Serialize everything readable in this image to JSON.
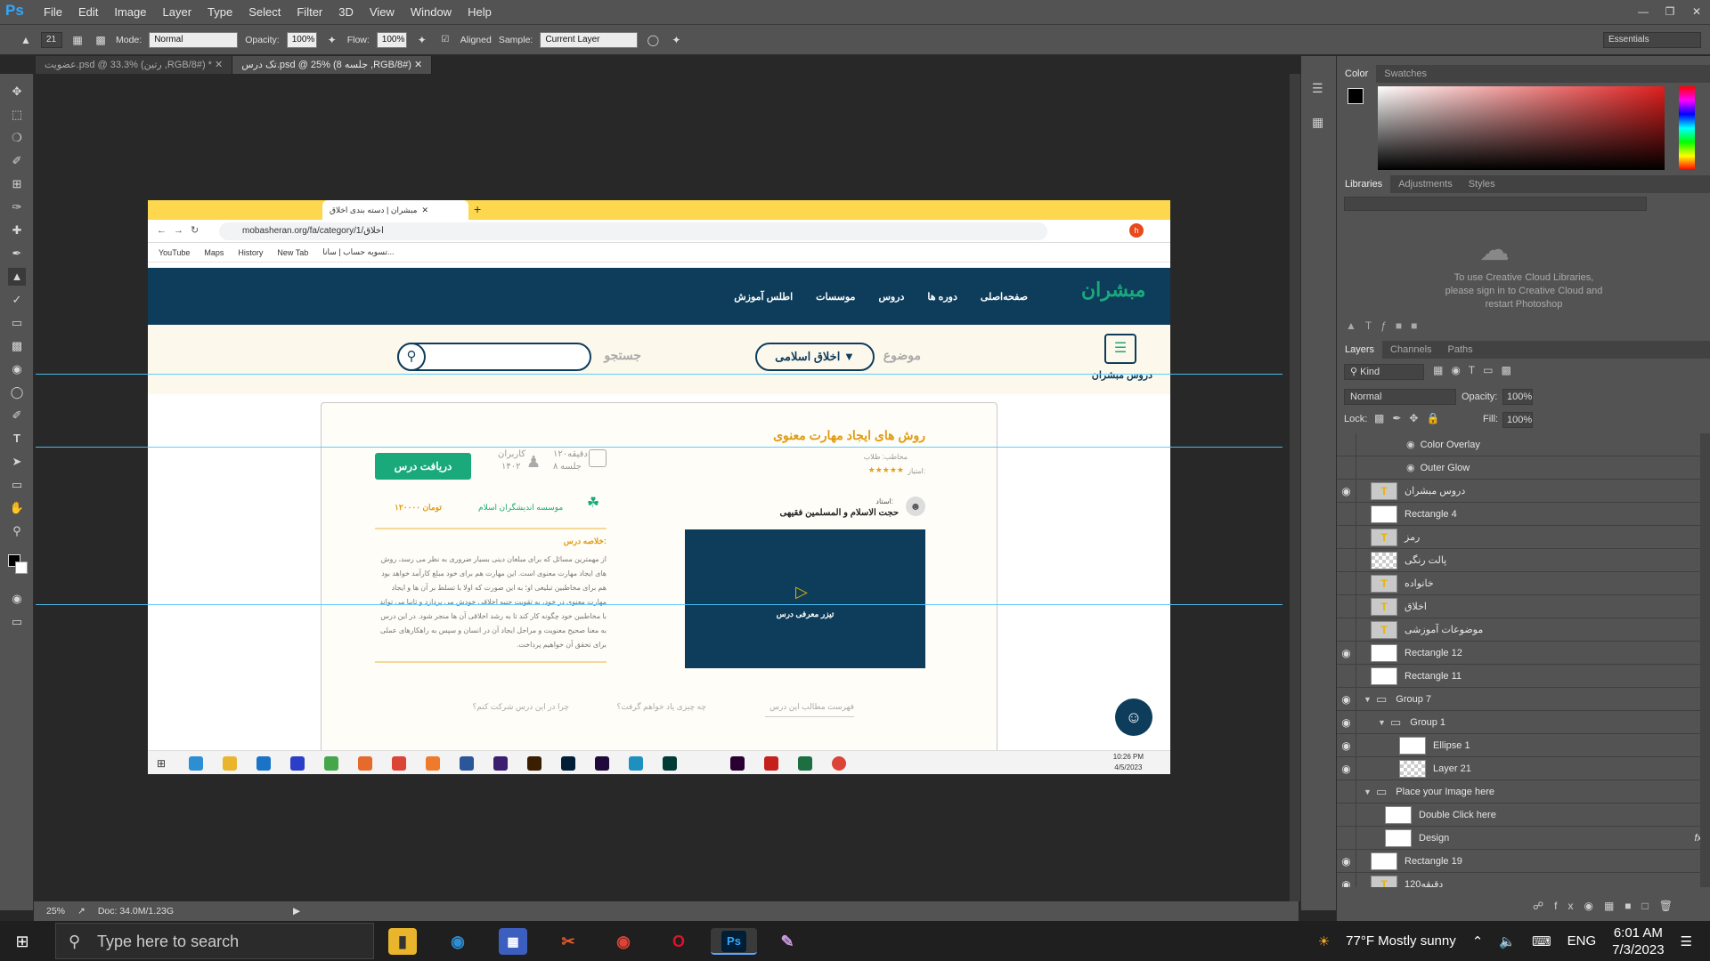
{
  "app": {
    "logo": "Ps",
    "menus": [
      "File",
      "Edit",
      "Image",
      "Layer",
      "Type",
      "Select",
      "Filter",
      "3D",
      "View",
      "Window",
      "Help"
    ]
  },
  "options": {
    "brush_size": "21",
    "mode_label": "Mode:",
    "mode": "Normal",
    "opacity_label": "Opacity:",
    "opacity": "100%",
    "flow_label": "Flow:",
    "flow": "100%",
    "aligned": "Aligned",
    "sample_label": "Sample:",
    "sample": "Current Layer",
    "workspace": "Essentials"
  },
  "doc_tabs": [
    {
      "label": "عضویت.psd @ 33.3% (رتین ,RGB/8#) *"
    },
    {
      "label": "تک درس.psd @ 25% (8 جلسه ,RGB/8#)"
    }
  ],
  "status": {
    "zoom": "25%",
    "doc": "Doc: 34.0M/1.23G"
  },
  "panels": {
    "color_tabs": [
      "Color",
      "Swatches"
    ],
    "lib_tabs": [
      "Libraries",
      "Adjustments",
      "Styles"
    ],
    "lib_msg": "To use Creative Cloud Libraries, please sign in to Creative Cloud and restart Photoshop",
    "layer_tabs": [
      "Layers",
      "Channels",
      "Paths"
    ],
    "kind": "Kind",
    "blend": "Normal",
    "opacity_label": "Opacity:",
    "opacity": "100%",
    "lock_label": "Lock:",
    "fill_label": "Fill:",
    "fill": "100%",
    "layers": [
      {
        "name": "Color Overlay",
        "eye": false,
        "thumb": "none",
        "indent": 3
      },
      {
        "name": "Outer Glow",
        "eye": false,
        "thumb": "none",
        "indent": 3
      },
      {
        "name": "دروس مبشران",
        "eye": true,
        "thumb": "T",
        "indent": 0
      },
      {
        "name": "Rectangle 4",
        "eye": false,
        "thumb": "rect",
        "indent": 0
      },
      {
        "name": "رمز",
        "eye": false,
        "thumb": "T",
        "indent": 0
      },
      {
        "name": "پالت رنگی",
        "eye": false,
        "thumb": "chk",
        "indent": 0
      },
      {
        "name": "خانواده",
        "eye": false,
        "thumb": "T",
        "indent": 0
      },
      {
        "name": "اخلاق",
        "eye": false,
        "thumb": "T",
        "indent": 0
      },
      {
        "name": "موضوعات آموزشی",
        "eye": false,
        "thumb": "T",
        "indent": 0
      },
      {
        "name": "Rectangle 12",
        "eye": true,
        "thumb": "rect",
        "indent": 0
      },
      {
        "name": "Rectangle 11",
        "eye": false,
        "thumb": "rect",
        "indent": 0
      },
      {
        "name": "Group 7",
        "eye": true,
        "thumb": "folder",
        "indent": 0,
        "open": true
      },
      {
        "name": "Group 1",
        "eye": true,
        "thumb": "folder",
        "indent": 1,
        "open": true
      },
      {
        "name": "Ellipse 1",
        "eye": true,
        "thumb": "rect",
        "indent": 2
      },
      {
        "name": "Layer 21",
        "eye": true,
        "thumb": "chk",
        "indent": 2
      },
      {
        "name": "Place your Image here",
        "eye": false,
        "thumb": "folder",
        "indent": 0,
        "open": true
      },
      {
        "name": "Double Click here",
        "eye": false,
        "thumb": "rect",
        "indent": 1
      },
      {
        "name": "Design",
        "eye": false,
        "thumb": "rect",
        "indent": 1,
        "fx": "fx"
      },
      {
        "name": "Rectangle 19",
        "eye": true,
        "thumb": "rect",
        "indent": 0
      },
      {
        "name": "دقیقه120",
        "eye": true,
        "thumb": "T",
        "indent": 0
      },
      {
        "name": "8 جلسه",
        "eye": true,
        "thumb": "T",
        "indent": 0,
        "selected": true
      }
    ]
  },
  "doc": {
    "browser": {
      "tab_title": "مبشران | دسته بندی اخلاق",
      "url": "mobasheran.org/fa/category/1/اخلاق",
      "bookmarks": [
        "YouTube",
        "Maps",
        "History",
        "New Tab",
        "تسویه حساب | سانا..."
      ]
    },
    "site": {
      "logo": "مبشران",
      "nav": [
        "صفحه‌اصلی",
        "دوره ها",
        "دروس",
        "موسسات",
        "اطلس آموزش"
      ],
      "brand_caption": "دروس مبشران",
      "topic_label": "موضوع",
      "topic_value": "اخلاق اسلامی",
      "search_label": "جستجو",
      "course": {
        "title": "روش های ایجاد مهارت معنوی",
        "subtitle": "مخاطب: طلاب",
        "rating_label": "امتیاز:",
        "stars": "★★★★★",
        "teacher_label": "استاد:",
        "teacher": "حجت الاسلام و المسلمین فقیهی",
        "duration": "۱۲۰دقیقه",
        "sessions": "۸ جلسه",
        "users_label": "کاربران",
        "users": "۱۴۰۲",
        "cta": "دریافت درس",
        "institute": "موسسه اندیشگران اسلام",
        "price": "۱۲۰۰۰۰ تومان",
        "summary_title": "خلاصه درس:",
        "summary": "از مهمترین مسائل که برای مبلغان دینی بسیار ضروری به نظر می رسد، روش های ایجاد مهارت معنوی است. این مهارت هم برای خود مبلغ کارآمد خواهد بود هم برای مخاطبین تبلیغی او؛ به این صورت که اولا با تسلط بر آن ها و ایجاد مهارت معنوی در خود، به تقویت جنبه اخلاقی خودش می پردازد و ثانیا می تواند با مخاطبین خود چگونه کار کند تا به رشد اخلاقی آن ها منجر شود. در این درس به معنا صحیح معنویت و مراحل ایجاد آن در انسان و سپس به راهکارهای عملی برای تحقق آن خواهیم پرداخت.",
        "video_caption": "تیزر معرفی درس",
        "bottom_tabs": [
          "فهرست مطالب این درس",
          "چه چیزی یاد خواهم گرفت؟",
          "چرا در این درس شرکت کنم؟"
        ]
      }
    },
    "taskbar_time": "10:26 PM",
    "taskbar_date": "4/5/2023"
  },
  "windows": {
    "search": "Type here to search",
    "weather": "77°F  Mostly sunny",
    "lang": "ENG",
    "time": "6:01 AM",
    "date": "7/3/2023"
  }
}
